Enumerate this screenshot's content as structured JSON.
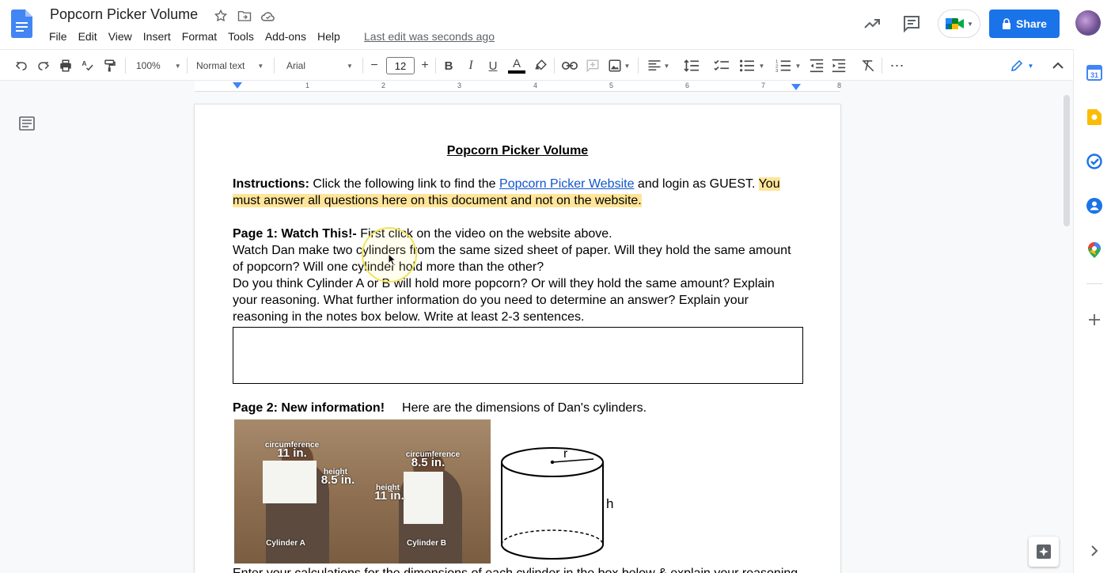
{
  "header": {
    "doc_title": "Popcorn Picker Volume",
    "menu": [
      "File",
      "Edit",
      "View",
      "Insert",
      "Format",
      "Tools",
      "Add-ons",
      "Help"
    ],
    "last_edit": "Last edit was seconds ago",
    "share_label": "Share",
    "brand_color": "#1a73e8"
  },
  "toolbar": {
    "zoom": "100%",
    "style": "Normal text",
    "font": "Arial",
    "font_size": "12",
    "minus": "−",
    "plus": "+",
    "bold": "B",
    "italic": "I",
    "underline": "U",
    "text_color": "A",
    "more": "⋯"
  },
  "ruler": {
    "numbers": [
      "1",
      "2",
      "3",
      "4",
      "5",
      "6",
      "7",
      "8"
    ]
  },
  "document": {
    "heading": "Popcorn Picker Volume",
    "instructions_label": "Instructions:",
    "instructions_text_1": " Click the following link to find the ",
    "link_text": "Popcorn Picker Website",
    "instructions_text_2": " and login as GUEST. ",
    "instructions_highlight": "You must answer all questions here on this document and not on the website.",
    "page1_label": "Page 1: Watch This!-",
    "page1_text": " First click on the video on the website above.",
    "para2": "Watch Dan make two cylinders from the same sized sheet of paper. Will they hold the same amount of popcorn? Will one cylinder hold more than the other?",
    "para3": "Do you think Cylinder A or B will hold more popcorn? Or will they hold the same amount? Explain your reasoning. What further information do you need to determine an answer? Explain your reasoning in the notes box below. Write at least 2-3 sentences.",
    "page2_label": "Page 2: New information!",
    "page2_text": "Here are the dimensions of Dan's cylinders.",
    "photo_a": {
      "circ_label": "circumference",
      "circ_value": "11 in.",
      "height_label": "height",
      "height_value": "8.5 in.",
      "caption": "Cylinder A"
    },
    "photo_b": {
      "circ_label": "circumference",
      "circ_value": "8.5 in.",
      "height_label": "height",
      "height_value": "11 in.",
      "caption": "Cylinder B"
    },
    "cyl_r": "r",
    "cyl_h": "h",
    "bottom_text": "Enter your calculations for the dimensions of each cylinder in the box below & explain your reasoning"
  },
  "colors": {
    "highlight": "#ffe599",
    "link": "#1155cc"
  }
}
